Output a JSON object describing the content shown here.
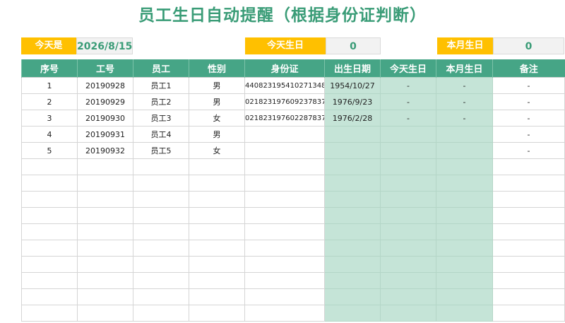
{
  "title": "员工生日自动提醒（根据身份证判断）",
  "info": {
    "today_label": "今天是",
    "today_value": "2026/8/15",
    "today_bday_label": "今天生日",
    "today_bday_count": "0",
    "month_bday_label": "本月生日",
    "month_bday_count": "0"
  },
  "table": {
    "headers": [
      "序号",
      "工号",
      "员工",
      "性别",
      "身份证",
      "出生日期",
      "今天生日",
      "本月生日",
      "备注"
    ],
    "rows": [
      [
        "1",
        "20190928",
        "员工1",
        "男",
        "440823195410271348",
        "1954/10/27",
        "-",
        "-",
        "-"
      ],
      [
        "2",
        "20190929",
        "员工2",
        "男",
        "021823197609237837",
        "1976/9/23",
        "-",
        "-",
        "-"
      ],
      [
        "3",
        "20190930",
        "员工3",
        "女",
        "021823197602287837",
        "1976/2/28",
        "-",
        "-",
        "-"
      ],
      [
        "4",
        "20190931",
        "员工4",
        "男",
        "",
        "",
        "",
        "",
        "-"
      ],
      [
        "5",
        "20190932",
        "员工5",
        "女",
        "",
        "",
        "",
        "",
        "-"
      ]
    ]
  },
  "colors": {
    "title": "#3a9c77",
    "header": "#46a586",
    "label": "#ffc000",
    "highlight": "#c5e4d7"
  }
}
